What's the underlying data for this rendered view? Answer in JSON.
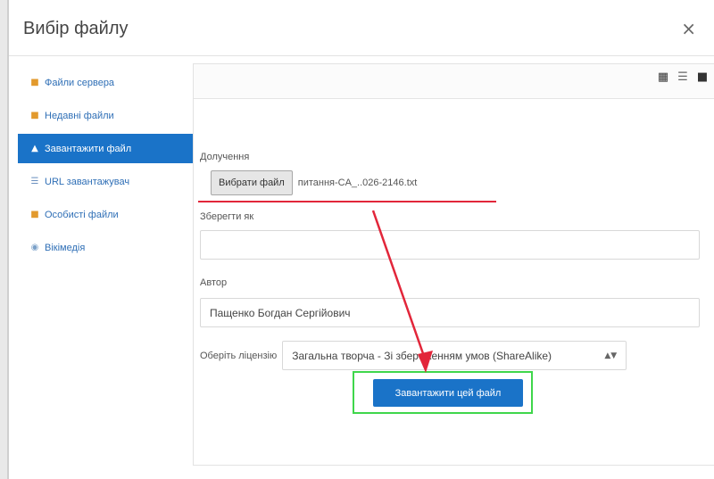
{
  "dialog": {
    "title": "Вибір файлу",
    "close_symbol": "×"
  },
  "sidebar": {
    "items": [
      {
        "label": "Файли сервера",
        "icon": "folder-icon",
        "active": false
      },
      {
        "label": "Недавні файли",
        "icon": "folder-icon",
        "active": false
      },
      {
        "label": "Завантажити файл",
        "icon": "upload-icon",
        "active": true
      },
      {
        "label": "URL завантажувач",
        "icon": "url-icon",
        "active": false
      },
      {
        "label": "Особисті файли",
        "icon": "folder-icon",
        "active": false
      },
      {
        "label": "Вікімедія",
        "icon": "wikimedia-icon",
        "active": false
      }
    ]
  },
  "toolbar": {
    "view_icons": [
      "grid-view-icon",
      "list-view-icon",
      "folder-view-icon"
    ]
  },
  "form": {
    "attachment_label": "Долучення",
    "choose_button": "Вибрати файл",
    "chosen_file": "питання-CA_..026-2146.txt",
    "save_as_label": "Зберегти як",
    "save_as_value": "",
    "author_label": "Автор",
    "author_value": "Пащенко Богдан Сергійович",
    "license_label": "Оберіть ліцензію",
    "license_value": "Загальна творча - Зі збереженням умов (ShareAlike)",
    "upload_button": "Завантажити цей файл"
  },
  "annotations": {
    "underline_color": "#e2263a",
    "arrow_color": "#e2263a",
    "highlight_color": "#3fd64b"
  }
}
